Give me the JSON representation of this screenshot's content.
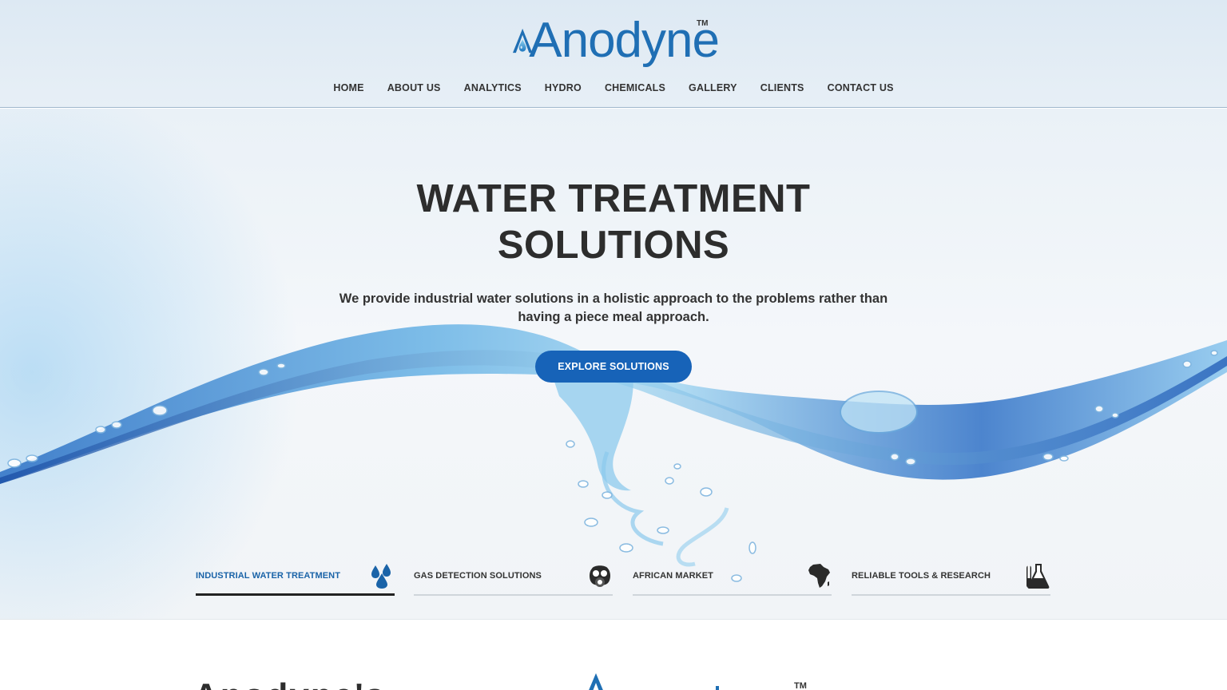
{
  "brand": {
    "name": "Anodyne",
    "tm": "TM"
  },
  "nav": {
    "items": [
      {
        "label": "HOME"
      },
      {
        "label": "ABOUT US"
      },
      {
        "label": "ANALYTICS"
      },
      {
        "label": "HYDRO"
      },
      {
        "label": "CHEMICALS"
      },
      {
        "label": "GALLERY"
      },
      {
        "label": "CLIENTS"
      },
      {
        "label": "CONTACT US"
      }
    ]
  },
  "hero": {
    "title_line1": "WATER TREATMENT",
    "title_line2": "SOLUTIONS",
    "subtitle_line1": "We provide industrial water solutions in a holistic approach to the problems rather than",
    "subtitle_line2": "having a piece meal approach.",
    "cta_label": "EXPLORE SOLUTIONS"
  },
  "tabs": [
    {
      "label": "INDUSTRIAL WATER TREATMENT",
      "icon": "water-drops-icon",
      "active": true
    },
    {
      "label": "GAS DETECTION SOLUTIONS",
      "icon": "gas-mask-icon",
      "active": false
    },
    {
      "label": "AFRICAN MARKET",
      "icon": "africa-map-icon",
      "active": false
    },
    {
      "label": "RELIABLE TOOLS & RESEARCH",
      "icon": "lab-flask-icon",
      "active": false
    }
  ],
  "below": {
    "heading": "Anodyne's",
    "tm": "TM"
  },
  "colors": {
    "accent": "#1763b8",
    "brand": "#1f6fb4",
    "text": "#2d2d2d"
  }
}
